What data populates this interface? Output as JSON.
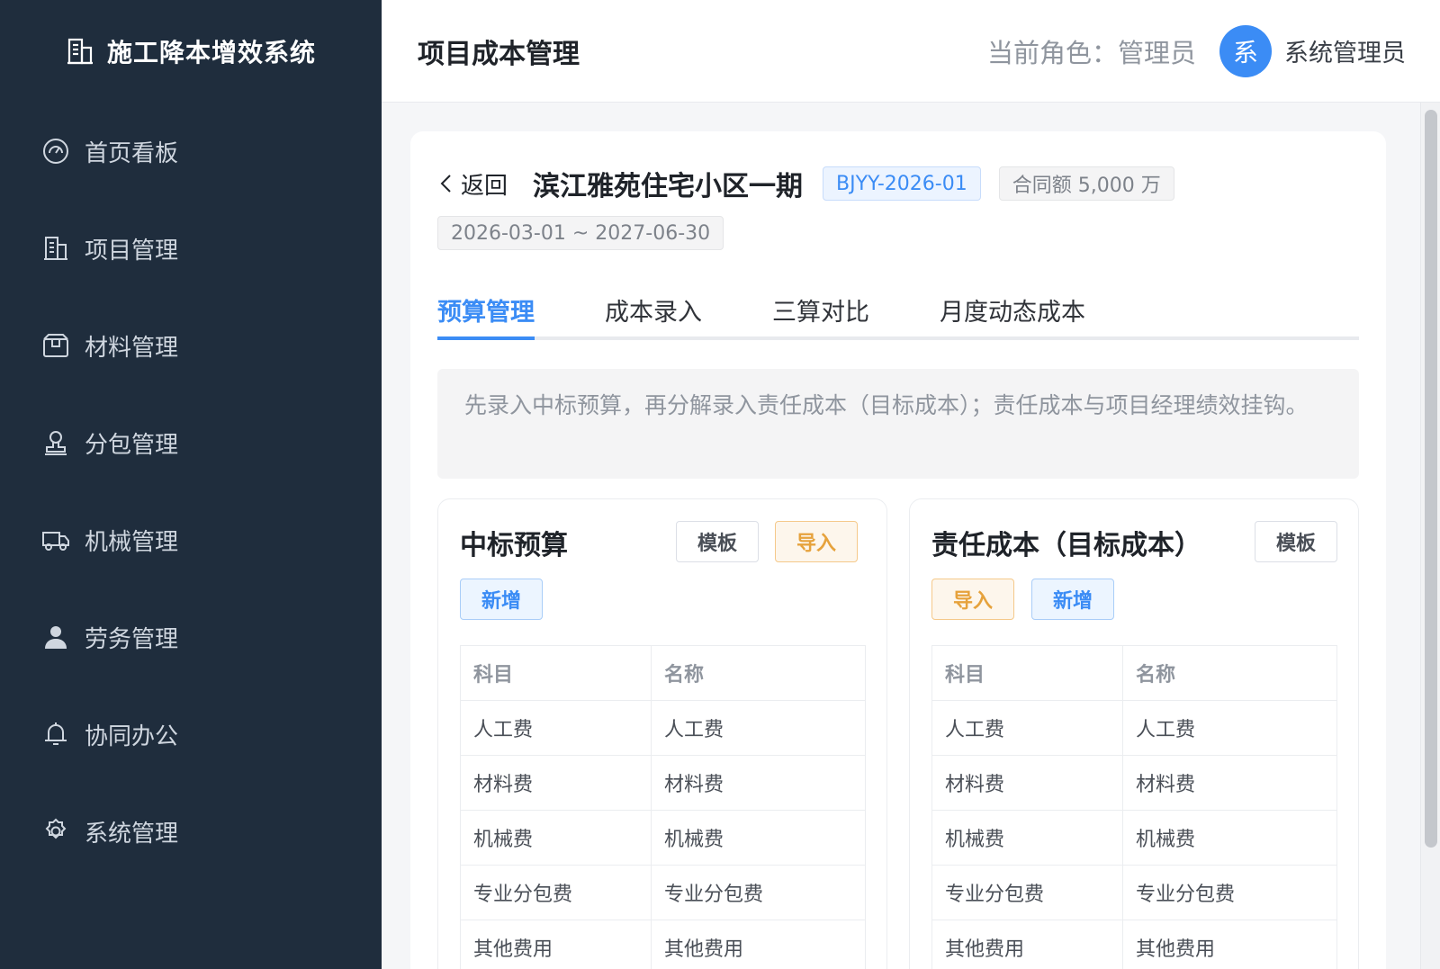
{
  "sidebar": {
    "brand": "施工降本增效系统",
    "items": [
      {
        "label": "首页看板",
        "icon": "dashboard-icon"
      },
      {
        "label": "项目管理",
        "icon": "building-icon"
      },
      {
        "label": "材料管理",
        "icon": "box-icon"
      },
      {
        "label": "分包管理",
        "icon": "stamp-icon"
      },
      {
        "label": "机械管理",
        "icon": "truck-icon"
      },
      {
        "label": "劳务管理",
        "icon": "user-icon"
      },
      {
        "label": "协同办公",
        "icon": "bell-icon"
      },
      {
        "label": "系统管理",
        "icon": "gear-icon"
      }
    ]
  },
  "header": {
    "title": "项目成本管理",
    "role": "当前角色：管理员",
    "avatar_char": "系",
    "user_name": "系统管理员"
  },
  "project": {
    "back_label": "返回",
    "name": "滨江雅苑住宅小区一期",
    "code": "BJYY-2026-01",
    "contract": "合同额 5,000 万",
    "period": "2026-03-01 ~ 2027-06-30"
  },
  "tabs": [
    {
      "label": "预算管理",
      "active": true
    },
    {
      "label": "成本录入",
      "active": false
    },
    {
      "label": "三算对比",
      "active": false
    },
    {
      "label": "月度动态成本",
      "active": false
    }
  ],
  "notice": "先录入中标预算，再分解录入责任成本（目标成本）；责任成本与项目经理绩效挂钩。",
  "panels": {
    "bid": {
      "title": "中标预算",
      "template_label": "模板",
      "import_label": "导入",
      "add_label": "新增"
    },
    "target": {
      "title": "责任成本（目标成本）",
      "template_label": "模板",
      "import_label": "导入",
      "add_label": "新增"
    }
  },
  "table": {
    "headers": [
      "科目",
      "名称"
    ],
    "rows": [
      [
        "人工费",
        "人工费"
      ],
      [
        "材料费",
        "材料费"
      ],
      [
        "机械费",
        "机械费"
      ],
      [
        "专业分包费",
        "专业分包费"
      ],
      [
        "其他费用",
        "其他费用"
      ]
    ]
  },
  "colors": {
    "sidebar_bg": "#1f2d3d",
    "accent": "#3b8cf5",
    "warning": "#e6a23c"
  }
}
